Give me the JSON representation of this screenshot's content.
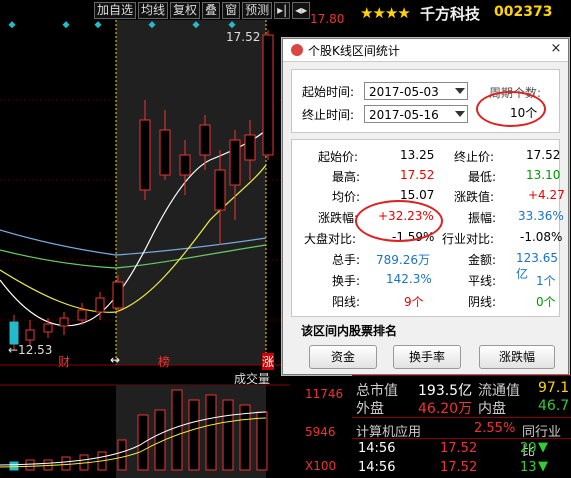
{
  "toolbar": {
    "items": [
      "加自选",
      "均线",
      "复权",
      "叠",
      "窗",
      "预测",
      "▸|",
      "◂▸"
    ],
    "price_right": "17.80"
  },
  "stock": {
    "stars": "★★★★",
    "name": "千方科技",
    "code": "002373"
  },
  "chart": {
    "marker_high": "17.52",
    "marker_low": "←12.53",
    "labels": {
      "cai": "财",
      "bang": "榜",
      "zhang": "涨",
      "arrows": "↔"
    },
    "volume_title": "成交量",
    "vol_axis": [
      "11746",
      "5946",
      "X100"
    ]
  },
  "dialog": {
    "title": "个股K线区间统计",
    "close": "×",
    "start_label": "起始时间:",
    "start_value": "2017-05-03",
    "end_label": "终止时间:",
    "end_value": "2017-05-16",
    "period_label": "周期个数:",
    "period_value": "10个",
    "stats": {
      "qsj_l": "起始价:",
      "qsj_v": "13.25",
      "zzj_l": "终止价:",
      "zzj_v": "17.52",
      "zg_l": "最高:",
      "zg_v": "17.52",
      "zd_l": "最低:",
      "zd_v": "13.10",
      "jj_l": "均价:",
      "jj_v": "15.07",
      "zdz_l": "涨跌值:",
      "zdz_v": "+4.27",
      "zdf_l": "涨跌幅:",
      "zdf_v": "+32.23%",
      "zf_l": "振幅:",
      "zf_v": "33.36%",
      "dpdb_l": "大盘对比:",
      "dpdb_v": "-1.59%",
      "hydb_l": "行业对比:",
      "hydb_v": "-1.08%",
      "zs_l": "总手:",
      "zs_v": "789.26万",
      "je_l": "金额:",
      "je_v": "123.65亿",
      "hs_l": "换手:",
      "hs_v": "142.3%",
      "px_l": "平线:",
      "px_v": "1个",
      "yangx_l": "阳线:",
      "yangx_v": "9个",
      "yinx_l": "阴线:",
      "yinx_v": "0个"
    },
    "rank_label": "该区间内股票排名",
    "buttons": [
      "资金",
      "换手率",
      "涨跌幅"
    ]
  },
  "info": {
    "zsz_l": "总市值",
    "zsz_v": "193.5亿",
    "ltz_l": "流通值",
    "ltz_v": "97.1",
    "wp_l": "外盘",
    "wp_v": "46.20万",
    "np_l": "内盘",
    "np_v": "46.7",
    "jsj_l": "计算机应用",
    "jsj_v": "2.55%",
    "thy_l": "同行业比",
    "t1_time": "14:56",
    "t1_price": "17.52",
    "t1_vol": "20",
    "t2_time": "14:56",
    "t2_price": "17.52",
    "t2_vol": "13"
  }
}
